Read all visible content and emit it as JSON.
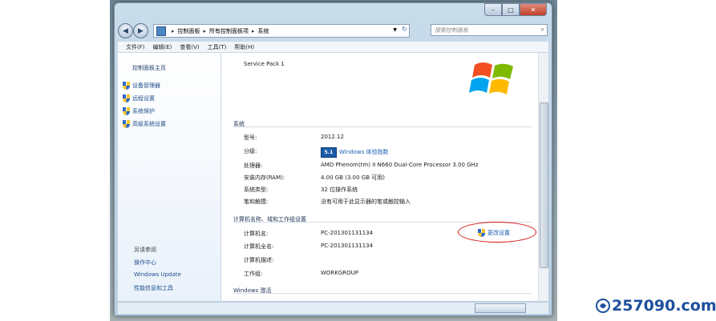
{
  "window": {
    "controls": {
      "minimize": "–",
      "maximize": "□",
      "close": "✕"
    }
  },
  "address": {
    "back_icon": "back-arrow-icon",
    "forward_icon": "forward-arrow-icon",
    "breadcrumb": [
      "控制面板",
      "所有控制面板项",
      "系统"
    ],
    "search_placeholder": "搜索控制面板"
  },
  "menu": [
    "文件(F)",
    "编辑(E)",
    "查看(V)",
    "工具(T)",
    "帮助(H)"
  ],
  "sidebar": {
    "home": "控制面板主页",
    "links": [
      "设备管理器",
      "远程设置",
      "系统保护",
      "高级系统设置"
    ],
    "see_also_title": "另请参阅",
    "see_also": [
      "操作中心",
      "Windows Update",
      "性能信息和工具"
    ]
  },
  "content": {
    "service_pack": "Service Pack 1",
    "system_section": "系统",
    "system_rows": [
      {
        "label": "型号:",
        "value": "2012.12"
      },
      {
        "label": "分级:",
        "value": ""
      },
      {
        "label": "处理器:",
        "value": "AMD Phenom(tm) II N660 Dual-Core Processor   3.00 GHz"
      },
      {
        "label": "安装内存(RAM):",
        "value": "4.00 GB (3.00 GB 可用)"
      },
      {
        "label": "系统类型:",
        "value": "32 位操作系统"
      },
      {
        "label": "笔和触摸:",
        "value": "没有可用于此显示器的笔或触控输入"
      }
    ],
    "wex_badge": "5.1",
    "wex_link": "Windows 体验指数",
    "computer_section": "计算机名称、域和工作组设置",
    "computer_rows": [
      {
        "label": "计算机名:",
        "value": "PC-201301131134"
      },
      {
        "label": "计算机全名:",
        "value": "PC-201301131134"
      },
      {
        "label": "计算机描述:",
        "value": ""
      },
      {
        "label": "工作组:",
        "value": "WORKGROUP"
      }
    ],
    "change_settings": "更改设置",
    "activation_section": "Windows 激活"
  },
  "watermark": "257090.com",
  "colors": {
    "link": "#1a5cb0",
    "highlight_ellipse": "#d21414",
    "watermark": "#1d4f9c"
  }
}
